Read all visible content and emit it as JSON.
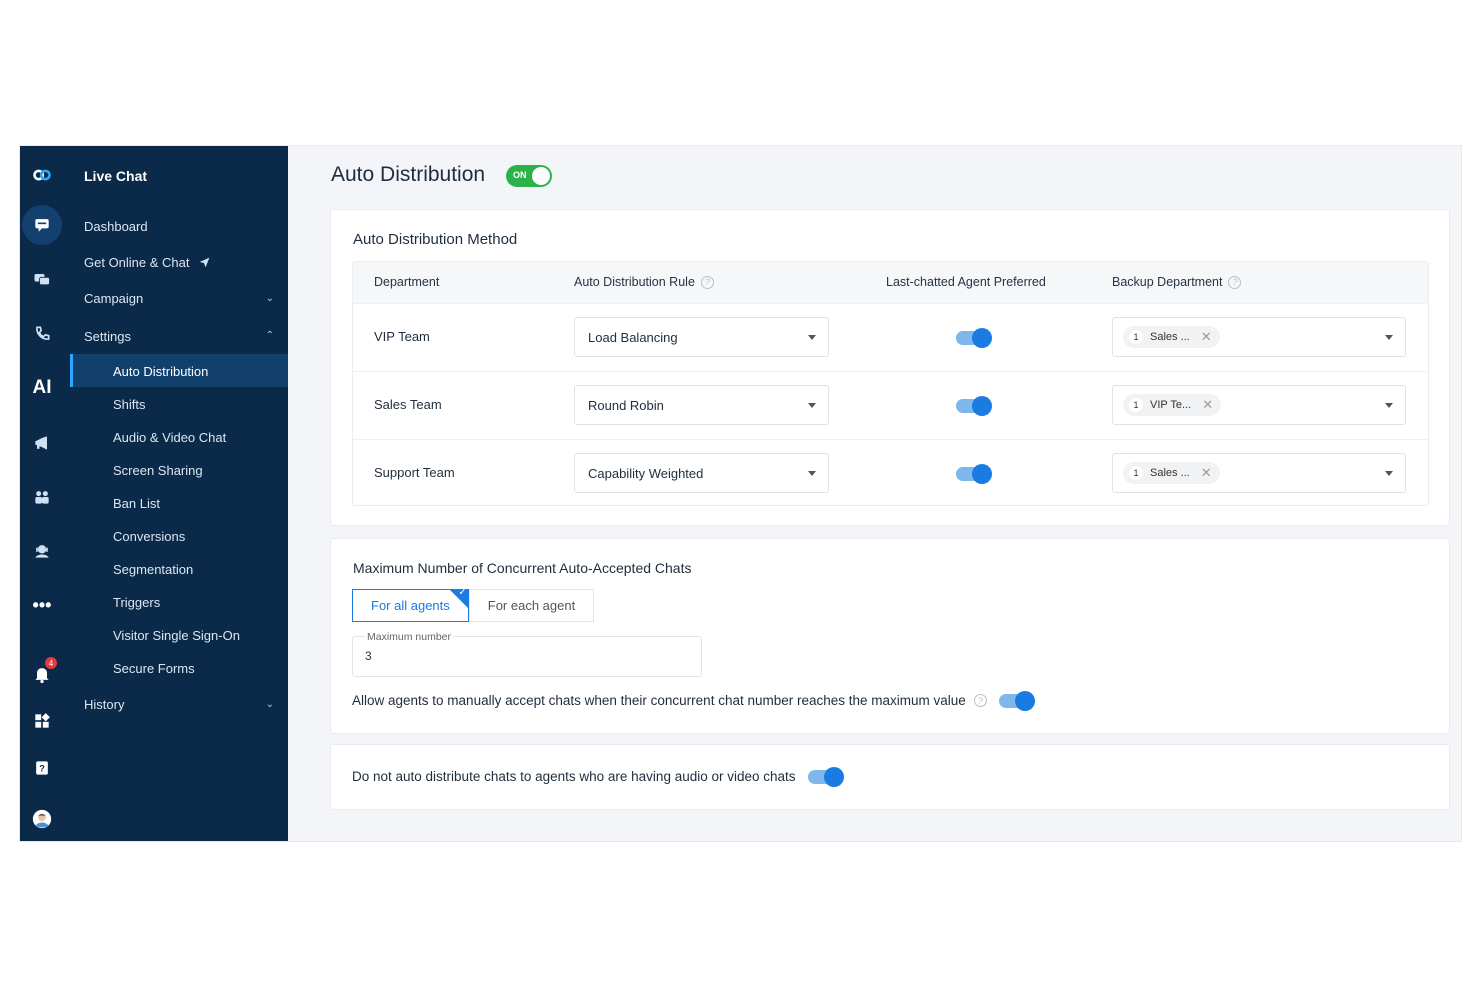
{
  "menu": {
    "title": "Live Chat",
    "items": [
      {
        "label": "Dashboard"
      },
      {
        "label": "Get Online & Chat"
      },
      {
        "label": "Campaign"
      },
      {
        "label": "Settings"
      }
    ],
    "settings_sub": [
      {
        "label": "Auto Distribution"
      },
      {
        "label": "Shifts"
      },
      {
        "label": "Audio & Video Chat"
      },
      {
        "label": "Screen Sharing"
      },
      {
        "label": "Ban List"
      },
      {
        "label": "Conversions"
      },
      {
        "label": "Segmentation"
      },
      {
        "label": "Triggers"
      },
      {
        "label": "Visitor Single Sign-On"
      },
      {
        "label": "Secure Forms"
      }
    ],
    "history": "History"
  },
  "rail": {
    "notification_count": "4"
  },
  "page": {
    "title": "Auto Distribution",
    "toggle_label": "ON"
  },
  "method": {
    "title": "Auto Distribution Method",
    "headers": {
      "department": "Department",
      "rule": "Auto Distribution Rule",
      "last_chatted": "Last-chatted Agent Preferred",
      "backup": "Backup Department"
    },
    "rows": [
      {
        "department": "VIP Team",
        "rule": "Load Balancing",
        "last_chatted_on": true,
        "backup_count": "1",
        "backup_tag": "Sales ..."
      },
      {
        "department": "Sales Team",
        "rule": "Round Robin",
        "last_chatted_on": true,
        "backup_count": "1",
        "backup_tag": "VIP Te..."
      },
      {
        "department": "Support Team",
        "rule": "Capability Weighted",
        "last_chatted_on": true,
        "backup_count": "1",
        "backup_tag": "Sales ..."
      }
    ]
  },
  "concurrent": {
    "title": "Maximum Number of Concurrent Auto-Accepted Chats",
    "option_all": "For all agents",
    "option_each": "For each agent",
    "field_label": "Maximum number",
    "field_value": "3",
    "allow_text": "Allow agents to manually accept chats when their concurrent chat number reaches the maximum value",
    "allow_on": true
  },
  "av": {
    "text": "Do not auto distribute chats to agents who are having audio or video chats",
    "on": true
  },
  "colors": {
    "sidebar": "#0b2a4a",
    "accent": "#1a7be0",
    "on_green": "#2bb34a"
  }
}
